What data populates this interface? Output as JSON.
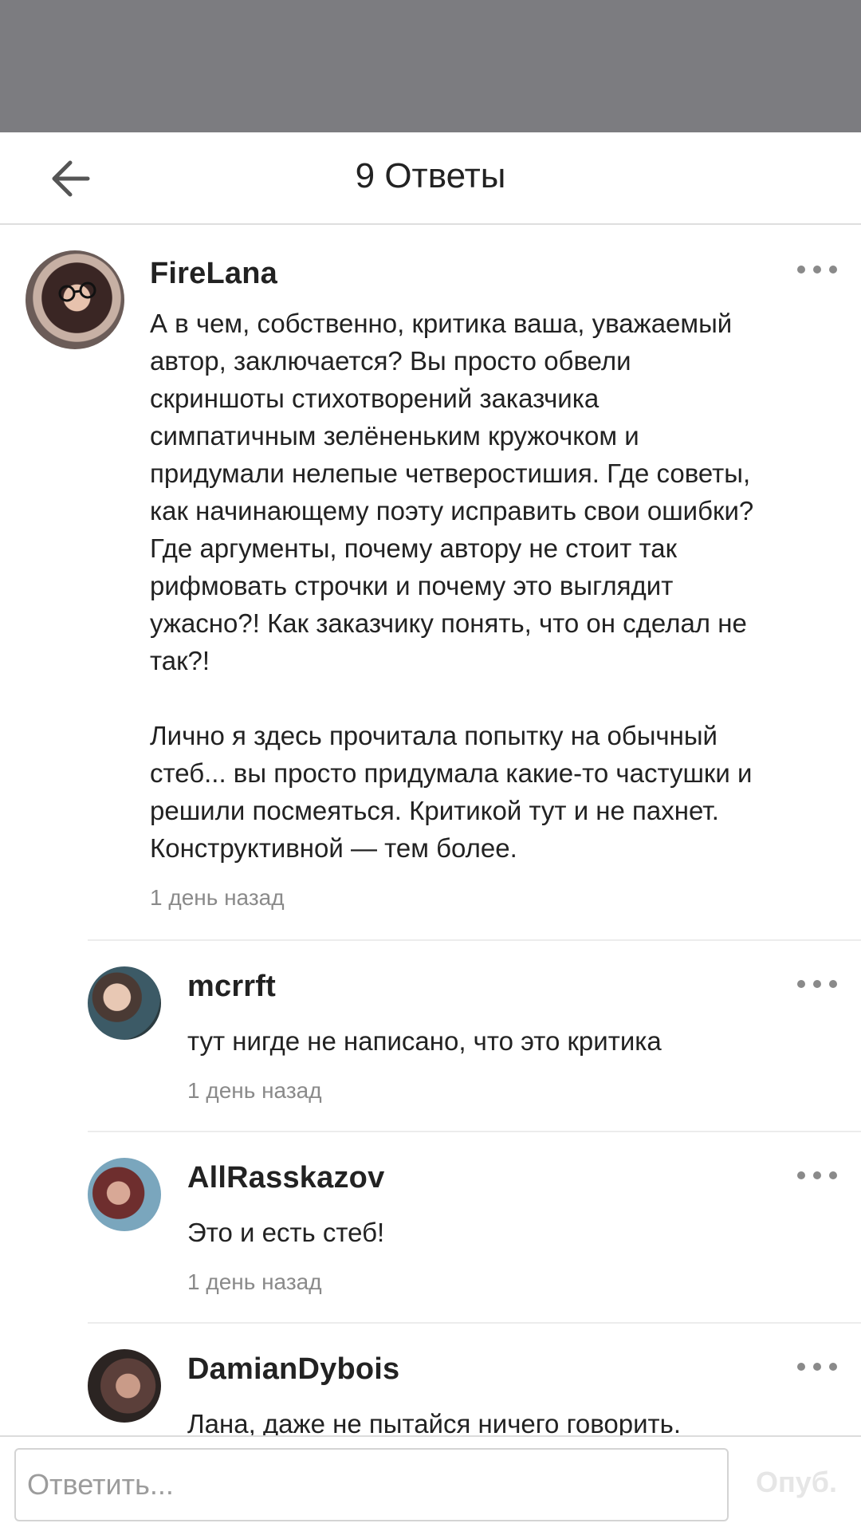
{
  "header": {
    "title": "9 Ответы"
  },
  "comments": [
    {
      "username": "FireLana",
      "paragraphs": [
        [
          "А в чем, собственно, критика ваша, уважаемый",
          "автор, заключается? Вы просто обвели",
          "скриншоты стихотворений заказчика",
          "симпатичным зелёненьким кружочком и",
          "придумали нелепые четверостишия. Где советы,",
          "как начинающему поэту исправить свои ошибки?",
          "Где аргументы, почему автору не стоит так",
          "рифмовать строчки и почему это выглядит",
          "ужасно?! Как заказчику понять, что он сделал не",
          "так?!"
        ],
        [
          "Лично я здесь прочитала попытку на обычный",
          "стеб... вы просто придумала какие-то частушки и",
          "решили посмеяться. Критикой тут и не пахнет.",
          "Конструктивной — тем более."
        ]
      ],
      "time": "1 день назад"
    },
    {
      "username": "mcrrft",
      "text": "тут нигде не написано, что это критика",
      "time": "1 день назад"
    },
    {
      "username": "AllRasskazov",
      "text": "Это и есть стеб!",
      "time": "1 день назад"
    },
    {
      "username": "DamianDybois",
      "text": "Лана, даже не пытайся ничего говорить.",
      "time": ""
    }
  ],
  "footer": {
    "placeholder": "Ответить...",
    "publish_label": "Опуб."
  },
  "colors": {
    "overlay": "#7c7c80",
    "muted": "#8a8a8a",
    "separator": "#ececec"
  },
  "icons": {
    "back": "arrow-left-icon",
    "more": "more-horizontal-icon"
  }
}
